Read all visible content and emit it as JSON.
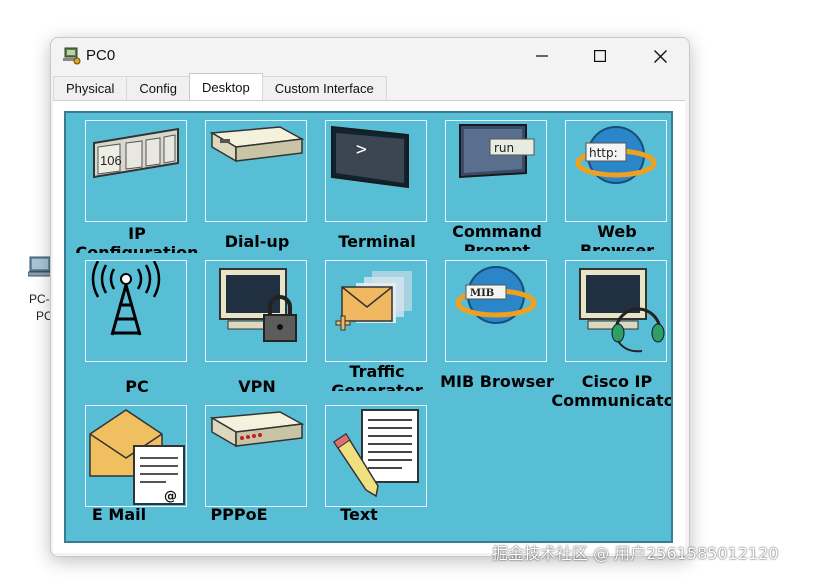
{
  "background_device": {
    "icon": "pc-icon",
    "label_line1": "PC-",
    "label_line2": "PC"
  },
  "window": {
    "title": "PC0",
    "icon": "packet-tracer-pc-icon",
    "controls": {
      "minimize": "minimize-icon",
      "maximize": "maximize-icon",
      "close": "close-icon"
    },
    "tabs": [
      {
        "label": "Physical",
        "active": false
      },
      {
        "label": "Config",
        "active": false
      },
      {
        "label": "Desktop",
        "active": true
      },
      {
        "label": "Custom Interface",
        "active": false
      }
    ]
  },
  "desktop": {
    "background_color": "#58bed6",
    "apps": [
      {
        "id": "ip-configuration",
        "icon": "ip-config-icon",
        "lines": [
          "IP",
          "Configuration"
        ]
      },
      {
        "id": "dial-up",
        "icon": "modem-icon",
        "lines": [
          "Dial-up"
        ]
      },
      {
        "id": "terminal",
        "icon": "terminal-icon",
        "lines": [
          "Terminal"
        ]
      },
      {
        "id": "command-prompt",
        "icon": "command-prompt-icon",
        "lines": [
          "Command",
          "Prompt"
        ]
      },
      {
        "id": "web-browser",
        "icon": "web-browser-icon",
        "lines": [
          "Web",
          "Browser"
        ]
      },
      {
        "id": "pc-wireless",
        "icon": "wireless-antenna-icon",
        "lines": [
          "PC"
        ]
      },
      {
        "id": "vpn",
        "icon": "vpn-lock-icon",
        "lines": [
          "VPN"
        ]
      },
      {
        "id": "traffic-generator",
        "icon": "traffic-generator-icon",
        "lines": [
          "Traffic",
          "Generator"
        ]
      },
      {
        "id": "mib-browser",
        "icon": "mib-browser-icon",
        "lines": [
          "MIB Browser"
        ]
      },
      {
        "id": "cisco-ip-communicator",
        "icon": "ip-communicator-headset-icon",
        "lines": [
          "Cisco IP",
          "Communicator"
        ]
      },
      {
        "id": "email",
        "icon": "email-icon",
        "lines": [
          "E Mail"
        ]
      },
      {
        "id": "pppoe",
        "icon": "pppoe-dialer-icon",
        "lines": [
          "PPPoE"
        ]
      },
      {
        "id": "text-editor",
        "icon": "text-editor-icon",
        "lines": [
          "Text"
        ]
      }
    ]
  },
  "watermark": "掘金技术社区 @ 用户2561585012120"
}
